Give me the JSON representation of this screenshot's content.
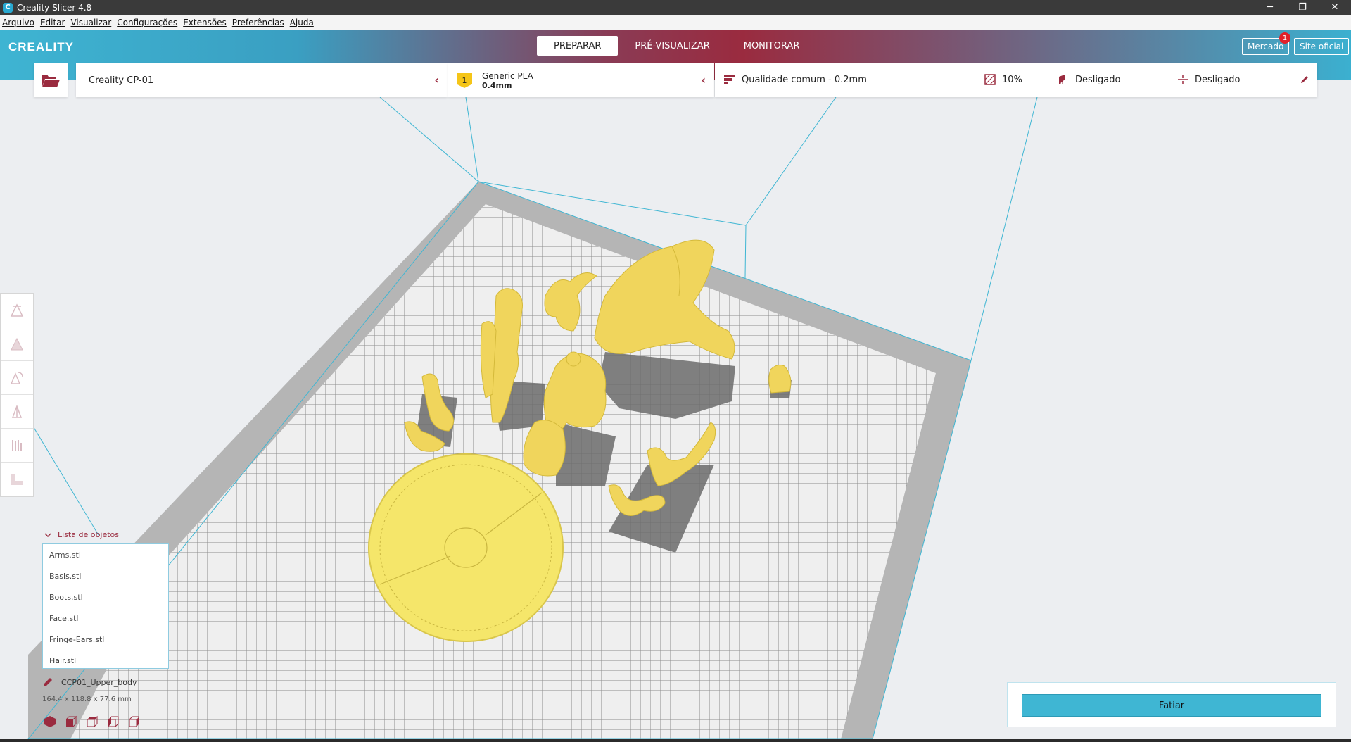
{
  "window": {
    "title": "Creality Slicer 4.8",
    "controls": [
      "─",
      "❐",
      "✕"
    ]
  },
  "menu": [
    "Arquivo",
    "Editar",
    "Visualizar",
    "Configurações",
    "Extensões",
    "Preferências",
    "Ajuda"
  ],
  "header": {
    "logo": "CREALITY",
    "tabs": [
      {
        "label": "PREPARAR",
        "active": true
      },
      {
        "label": "PRÉ-VISUALIZAR",
        "active": false
      },
      {
        "label": "MONITORAR",
        "active": false
      }
    ],
    "market_label": "Mercado",
    "market_badge": "1",
    "site_label": "Site oficial"
  },
  "printer": {
    "name": "Creality CP-01"
  },
  "material": {
    "index": "1",
    "name": "Generic PLA",
    "nozzle": "0.4mm"
  },
  "quality": {
    "profile": "Qualidade comum - 0.2mm",
    "infill": "10%",
    "support": "Desligado",
    "adhesion": "Desligado"
  },
  "tools": [
    "move-icon",
    "scale-icon",
    "rotate-icon",
    "mirror-icon",
    "per-model-settings-icon",
    "support-blocker-icon"
  ],
  "object_list": {
    "header": "Lista de objetos",
    "items": [
      "Arms.stl",
      "Basis.stl",
      "Boots.stl",
      "Face.stl",
      "Fringe-Ears.stl",
      "Hair.stl"
    ]
  },
  "selected_object": {
    "name": "CCP01_Upper_body",
    "dimensions": "164.4 x 118.8 x 77.6 mm"
  },
  "slice": {
    "label": "Fatiar"
  },
  "colors": {
    "accent": "#9a2b3f",
    "primary": "#3fb6d3",
    "model": "#f0d55c"
  }
}
